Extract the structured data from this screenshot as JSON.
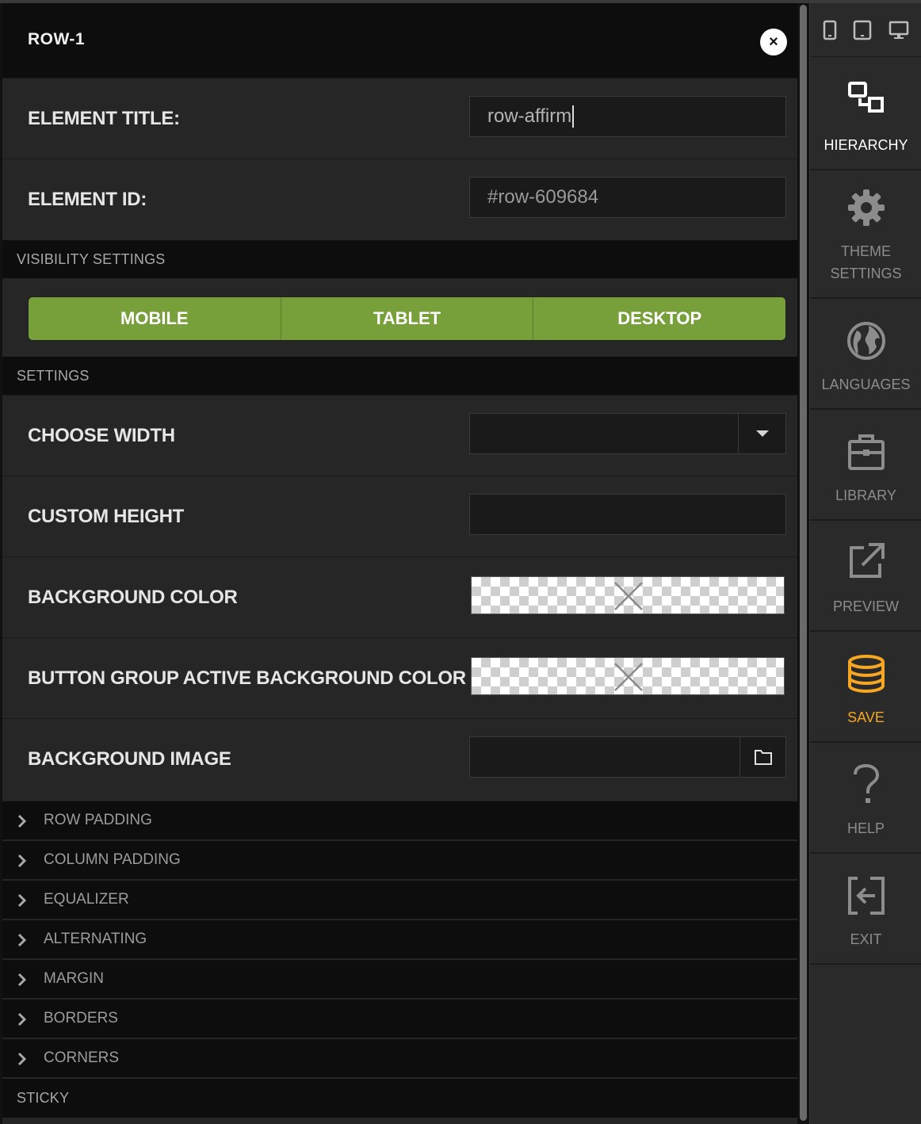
{
  "panel": {
    "title": "ROW-1",
    "close_label": "×"
  },
  "fields": {
    "element_title": {
      "label": "ELEMENT TITLE:",
      "value": "row-affirm"
    },
    "element_id": {
      "label": "ELEMENT ID:",
      "value": "#row-609684"
    }
  },
  "visibility": {
    "section_label": "VISIBILITY SETTINGS",
    "buttons": [
      "MOBILE",
      "TABLET",
      "DESKTOP"
    ]
  },
  "settings": {
    "section_label": "SETTINGS",
    "choose_width": "CHOOSE WIDTH",
    "custom_height": "CUSTOM HEIGHT",
    "background_color": "BACKGROUND COLOR",
    "button_group_active_bg": "BUTTON GROUP ACTIVE BACKGROUND COLOR",
    "background_image": "BACKGROUND IMAGE"
  },
  "accordions": [
    "ROW PADDING",
    "COLUMN PADDING",
    "EQUALIZER",
    "ALTERNATING",
    "MARGIN",
    "BORDERS",
    "CORNERS"
  ],
  "sticky_label": "STICKY",
  "sidebar": {
    "items": [
      {
        "id": "hierarchy",
        "line1": "HIERARCHY",
        "line2": "",
        "icon": "hierarchy-icon"
      },
      {
        "id": "theme",
        "line1": "THEME",
        "line2": "SETTINGS",
        "icon": "gear-icon"
      },
      {
        "id": "languages",
        "line1": "LANGUAGES",
        "line2": "",
        "icon": "globe-icon"
      },
      {
        "id": "library",
        "line1": "LIBRARY",
        "line2": "",
        "icon": "briefcase-icon"
      },
      {
        "id": "preview",
        "line1": "PREVIEW",
        "line2": "",
        "icon": "external-link-icon"
      },
      {
        "id": "save",
        "line1": "SAVE",
        "line2": "",
        "icon": "database-icon"
      },
      {
        "id": "help",
        "line1": "HELP",
        "line2": "",
        "icon": "question-icon"
      },
      {
        "id": "exit",
        "line1": "EXIT",
        "line2": "",
        "icon": "exit-icon"
      }
    ]
  },
  "colors": {
    "green": "#77a03b",
    "save_orange": "#f5a623",
    "dark": "#0d0d0d",
    "panel": "#262626"
  }
}
